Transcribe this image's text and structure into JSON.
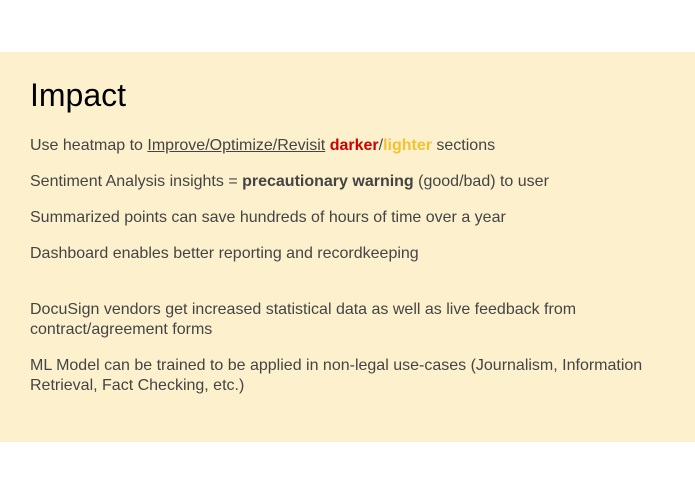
{
  "slide": {
    "title": "Impact",
    "points": [
      {
        "pre": "Use heatmap to ",
        "link": "Improve/Optimize/Revisit",
        "space": " ",
        "dark": "darker",
        "slash": "/",
        "light": "lighter",
        "post": " sections"
      },
      {
        "pre": "Sentiment Analysis insights = ",
        "bold": "precautionary warning",
        "post": " (good/bad) to user"
      },
      {
        "text": "Summarized points can save hundreds of hours of time over a year"
      },
      {
        "text": "Dashboard enables better reporting and recordkeeping"
      },
      {
        "text": "DocuSign vendors get increased statistical data as well as live feedback from contract/agreement forms"
      },
      {
        "text": "ML Model can be trained to be applied in non-legal use-cases (Journalism, Information Retrieval, Fact Checking, etc.)"
      }
    ]
  },
  "colors": {
    "background": "#fdf1cd",
    "text": "#444444",
    "darker": "#cc0000",
    "lighter": "#f1c232"
  }
}
